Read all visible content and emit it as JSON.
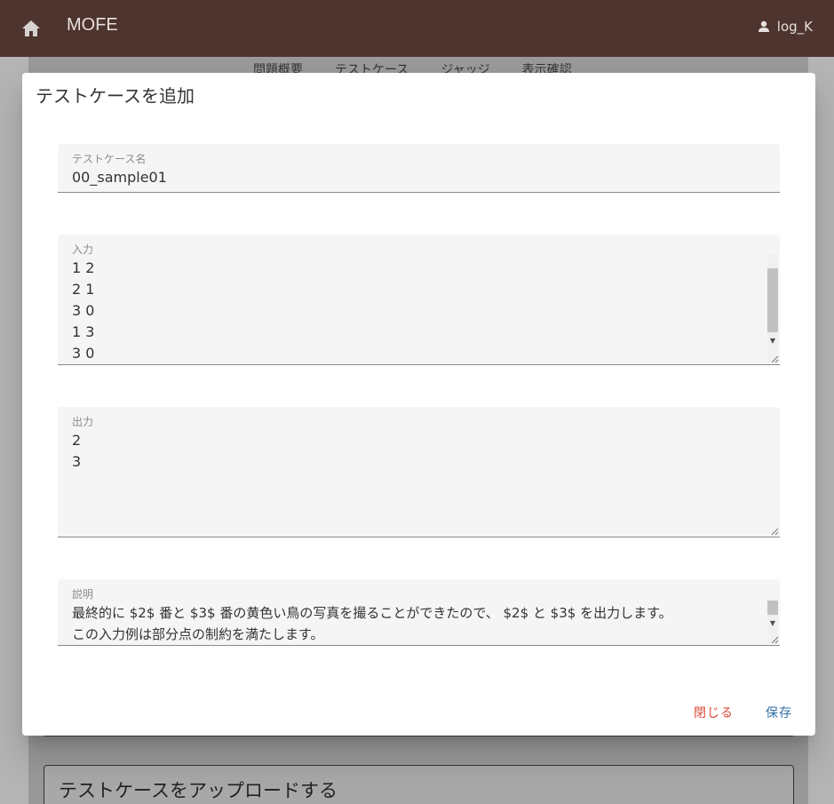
{
  "appbar": {
    "brand": "MOFE",
    "user": "log_K",
    "home_icon": "home-icon",
    "user_icon": "person-icon"
  },
  "background": {
    "tabs": [
      "問題概要",
      "テストケース",
      "ジャッジ",
      "表示確認"
    ],
    "upload_title": "テストケースをアップロードする"
  },
  "dialog": {
    "title": "テストケースを追加",
    "fields": {
      "name": {
        "label": "テストケース名",
        "value": "00_sample01"
      },
      "input": {
        "label": "入力",
        "value": "1 2\n2 1\n3 0\n1 3\n3 0"
      },
      "output": {
        "label": "出力",
        "value": "2\n3"
      },
      "description": {
        "label": "説明",
        "value": "最終的に $2$ 番と $3$ 番の黄色い鳥の写真を撮ることができたので、 $2$ と $3$ を出力します。\nこの入力例は部分点の制約を満たします。"
      }
    },
    "actions": {
      "close": "閉じる",
      "save": "保存"
    }
  },
  "colors": {
    "appbar": "#4e342e",
    "close": "#d84a3a",
    "save": "#2e6ea6"
  }
}
